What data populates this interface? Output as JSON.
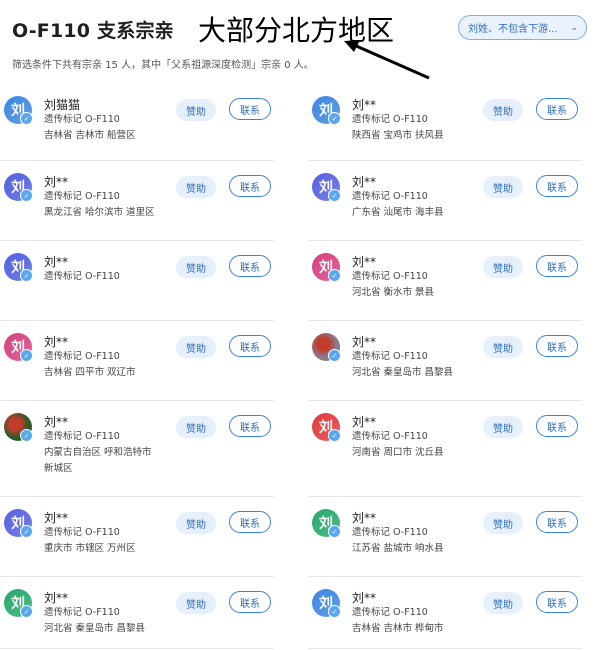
{
  "header": {
    "title": "O-F110 支系宗亲",
    "annotation": "大部分北方地区",
    "filter_label": "刘姓、不包含下游...",
    "summary": "筛选条件下共有宗亲 15 人，其中「父系祖源深度检测」宗亲 0 人。"
  },
  "labels": {
    "sponsor": "赞助",
    "contact": "联系"
  },
  "colors": {
    "accent": "#2d6dbe",
    "badge": "#5aa7f0",
    "annotation": "#000000"
  },
  "left_column": [
    {
      "name": "刘猫猫",
      "marker": "遗传标记 O-F110",
      "location": "吉林省 吉林市 船营区",
      "avatar_text": "刘",
      "avatar_color": "#3b86e0"
    },
    {
      "name": "刘**",
      "marker": "遗传标记 O-F110",
      "location": "黑龙江省 哈尔滨市 道里区",
      "avatar_text": "刘",
      "avatar_color": "#4f5ee0"
    },
    {
      "name": "刘**",
      "marker": "遗传标记 O-F110",
      "location": "",
      "avatar_text": "刘",
      "avatar_color": "#4f5ee0"
    },
    {
      "name": "刘**",
      "marker": "遗传标记 O-F110",
      "location": "吉林省 四平市 双辽市",
      "avatar_text": "刘",
      "avatar_color": "#d6407f"
    },
    {
      "name": "刘**",
      "marker": "遗传标记 O-F110",
      "location": "内蒙古自治区 呼和浩特市",
      "location2": "新城区",
      "avatar_text": "",
      "avatar_color": "#2f5a2a"
    },
    {
      "name": "刘**",
      "marker": "遗传标记 O-F110",
      "location": "重庆市 市辖区 万州区",
      "avatar_text": "刘",
      "avatar_color": "#5660e0"
    },
    {
      "name": "刘**",
      "marker": "遗传标记 O-F110",
      "location": "河北省 秦皇岛市 昌黎县",
      "avatar_text": "刘",
      "avatar_color": "#25a86a"
    }
  ],
  "right_column": [
    {
      "name": "刘**",
      "marker": "遗传标记 O-F110",
      "location": "陕西省 宝鸡市 扶风县",
      "avatar_text": "刘",
      "avatar_color": "#3b86e0"
    },
    {
      "name": "刘**",
      "marker": "遗传标记 O-F110",
      "location": "广东省 汕尾市 海丰县",
      "avatar_text": "刘",
      "avatar_color": "#5660e0"
    },
    {
      "name": "刘**",
      "marker": "遗传标记 O-F110",
      "location": "河北省 衡水市 景县",
      "avatar_text": "刘",
      "avatar_color": "#d6407f"
    },
    {
      "name": "刘**",
      "marker": "遗传标记 O-F110",
      "location": "河北省 秦皇岛市 昌黎县",
      "avatar_text": "",
      "avatar_color": "#8a7a8c"
    },
    {
      "name": "刘**",
      "marker": "遗传标记 O-F110",
      "location": "河南省 周口市 沈丘县",
      "avatar_text": "刘",
      "avatar_color": "#e0393b"
    },
    {
      "name": "刘**",
      "marker": "遗传标记 O-F110",
      "location": "江苏省 盐城市 响水县",
      "avatar_text": "刘",
      "avatar_color": "#25a86a"
    },
    {
      "name": "刘**",
      "marker": "遗传标记 O-F110",
      "location": "吉林省 吉林市 桦甸市",
      "avatar_text": "刘",
      "avatar_color": "#3b86e0"
    }
  ]
}
